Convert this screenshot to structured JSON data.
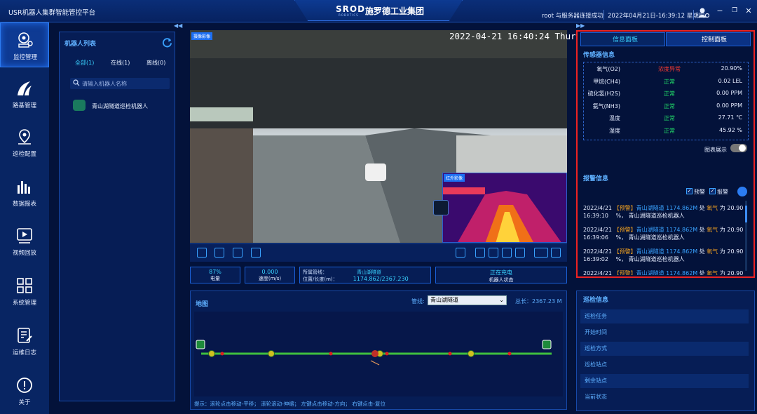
{
  "app_title": "USR机器人集群智能管控平台",
  "brand": {
    "logo": "SROD",
    "logo_sub": "ROBOTICS",
    "name": "施罗德工业集团"
  },
  "header": {
    "conn_status": "root 与服务器连接成功",
    "datetime": "2022年04月21日-16:39:12 星期四"
  },
  "window_buttons": [
    "−",
    "❐",
    "✕"
  ],
  "nav": [
    {
      "label": "监控管理",
      "icon": "monitor-icon",
      "active": true
    },
    {
      "label": "路基管理",
      "icon": "road-icon"
    },
    {
      "label": "巡检配置",
      "icon": "location-icon"
    },
    {
      "label": "数据报表",
      "icon": "bar-chart-icon"
    },
    {
      "label": "视频回放",
      "icon": "play-icon"
    },
    {
      "label": "系统管理",
      "icon": "grid-icon"
    },
    {
      "label": "运维日志",
      "icon": "log-icon"
    },
    {
      "label": "关于",
      "icon": "info-icon"
    }
  ],
  "robot_list": {
    "title": "机器人列表",
    "tabs": [
      {
        "label": "全部(1)",
        "active": true
      },
      {
        "label": "在线(1)"
      },
      {
        "label": "离线(0)"
      }
    ],
    "search_placeholder": "请输入机器人名称",
    "items": [
      "青山湖隧道巡检机器人"
    ]
  },
  "video": {
    "label": "摄像影像",
    "timestamp": "2022-04-21 16:40:24 Thur",
    "ir_label": "红外影像"
  },
  "stats": [
    {
      "value": "87%",
      "label": "电量"
    },
    {
      "value": "0.000",
      "label": "速度(m/s)"
    },
    {
      "k1": "所属管线：",
      "v1": "青山湖隧道",
      "k2": "位置/长度(m)：",
      "v2": "1174.862/2367.230"
    },
    {
      "value": "正在充电",
      "label": "机器人状态"
    }
  ],
  "map": {
    "title": "地图",
    "pipe_label": "管线:",
    "pipe_value": "青山湖隧道",
    "total_len": "总长：2367.23 M",
    "hint": "提示：滚轮点击移动-平移；  滚轮滚动-伸缩；  左键点击移动-方向；  右键点击-复位",
    "robot_position_fraction": 0.496
  },
  "right_tabs": {
    "info": "信息面板",
    "control": "控制面板"
  },
  "sensors": {
    "title": "传感器信息",
    "rows": [
      {
        "name": "氧气(O2)",
        "status": "浓度异常",
        "status_color": "#ff3b30",
        "value": "20.90%"
      },
      {
        "name": "甲烷(CH4)",
        "status": "正常",
        "status_color": "#22e06a",
        "value": "0.02 LEL"
      },
      {
        "name": "硫化氢(H2S)",
        "status": "正常",
        "status_color": "#22e06a",
        "value": "0.00 PPM"
      },
      {
        "name": "氨气(NH3)",
        "status": "正常",
        "status_color": "#22e06a",
        "value": "0.00 PPM"
      },
      {
        "name": "温度",
        "status": "正常",
        "status_color": "#22e06a",
        "value": "27.71 ℃"
      },
      {
        "name": "湿度",
        "status": "正常",
        "status_color": "#22e06a",
        "value": "45.92 %"
      }
    ],
    "chart_toggle_label": "图表展示"
  },
  "alarms": {
    "title": "报警信息",
    "filters": [
      "预警",
      "报警"
    ],
    "items": [
      {
        "date": "2022/4/21",
        "time": "16:39:10",
        "tag": "【预警】",
        "where": "青山湖隧道 1174.862M",
        "mid": "处",
        "gas": "氧气",
        "pre": "为 20.90",
        "unit": "%，",
        "robot": "青山湖隧道巡检机器人"
      },
      {
        "date": "2022/4/21",
        "time": "16:39:06",
        "tag": "【预警】",
        "where": "青山湖隧道 1174.862M",
        "mid": "处",
        "gas": "氧气",
        "pre": "为 20.90",
        "unit": "%，",
        "robot": "青山湖隧道巡检机器人"
      },
      {
        "date": "2022/4/21",
        "time": "16:39:02",
        "tag": "【预警】",
        "where": "青山湖隧道 1174.862M",
        "mid": "处",
        "gas": "氧气",
        "pre": "为 20.90",
        "unit": "%，",
        "robot": "青山湖隧道巡检机器人"
      },
      {
        "date": "2022/4/21",
        "time": "",
        "tag": "【预警】",
        "where": "青山湖隧道 1174.862M",
        "mid": "处",
        "gas": "氧气",
        "pre": "为 20.90",
        "unit": "",
        "robot": ""
      }
    ]
  },
  "patrol": {
    "title": "巡检信息",
    "rows": [
      "巡检任务",
      "开始时间",
      "巡检方式",
      "巡检站点",
      "剩余站点",
      "当前状态"
    ]
  }
}
